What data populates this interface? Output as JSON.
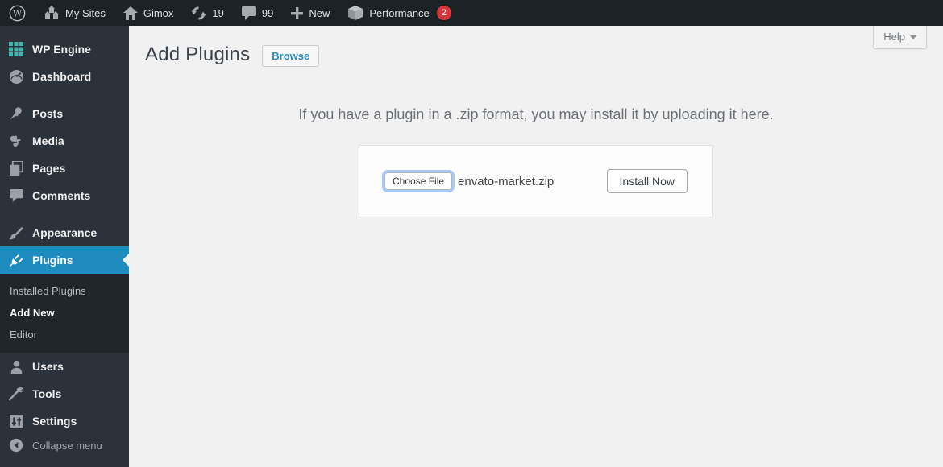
{
  "admin_bar": {
    "my_sites_label": "My Sites",
    "site_name": "Gimox",
    "updates_count": "19",
    "comments_count": "99",
    "new_label": "New",
    "performance_label": "Performance",
    "performance_badge": "2"
  },
  "sidebar": {
    "items": [
      {
        "label": "WP Engine"
      },
      {
        "label": "Dashboard"
      },
      {
        "label": "Posts"
      },
      {
        "label": "Media"
      },
      {
        "label": "Pages"
      },
      {
        "label": "Comments"
      },
      {
        "label": "Appearance"
      },
      {
        "label": "Plugins"
      },
      {
        "label": "Users"
      },
      {
        "label": "Tools"
      },
      {
        "label": "Settings"
      }
    ],
    "submenu": {
      "items": [
        {
          "label": "Installed Plugins"
        },
        {
          "label": "Add New"
        },
        {
          "label": "Editor"
        }
      ]
    },
    "collapse_label": "Collapse menu"
  },
  "header": {
    "title": "Add Plugins",
    "browse_label": "Browse",
    "help_label": "Help"
  },
  "main": {
    "intro_text": "If you have a plugin in a .zip format, you may install it by uploading it here.",
    "choose_file_label": "Choose File",
    "file_name": "envato-market.zip",
    "install_label": "Install Now"
  },
  "colors": {
    "active_menu_blue": "#1e8cbe",
    "link_blue": "#2e8bbe",
    "badge_red": "#d63638",
    "wpengine_teal": "#41b7ac",
    "topbar_bg": "#1d2227",
    "sidebar_bg": "#2b323a",
    "content_bg": "#f1f1f1"
  }
}
